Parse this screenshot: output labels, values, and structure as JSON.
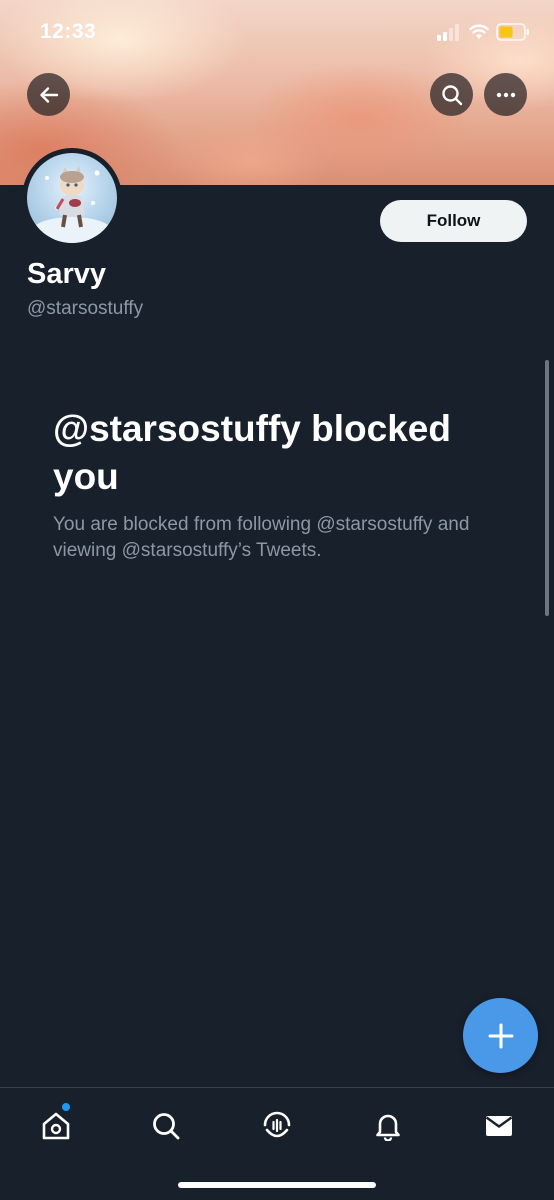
{
  "status_bar": {
    "time": "12:33",
    "signal_icon": "cellular-signal-icon",
    "wifi_icon": "wifi-icon",
    "battery_icon": "battery-icon",
    "battery_color": "#f5c518"
  },
  "header": {
    "back_icon": "arrow-left-icon",
    "search_icon": "search-icon",
    "more_icon": "more-horizontal-icon"
  },
  "profile": {
    "display_name": "Sarvy",
    "handle": "@starsostuffy",
    "follow_label": "Follow"
  },
  "blocked": {
    "title": "@starsostuffy blocked you",
    "message": "You are blocked from following @starsostuffy and viewing @starsostuffy’s Tweets."
  },
  "fab": {
    "icon": "plus-icon",
    "color": "#4a99e9"
  },
  "tab_bar": {
    "items": [
      {
        "name": "home",
        "icon": "home-icon",
        "has_notification_dot": true
      },
      {
        "name": "search",
        "icon": "search-icon"
      },
      {
        "name": "spaces",
        "icon": "spaces-icon"
      },
      {
        "name": "notifications",
        "icon": "bell-icon"
      },
      {
        "name": "messages",
        "icon": "envelope-icon"
      }
    ]
  },
  "colors": {
    "background": "#18202b",
    "secondary_text": "#8b98a5",
    "accent": "#1d9bf0"
  }
}
